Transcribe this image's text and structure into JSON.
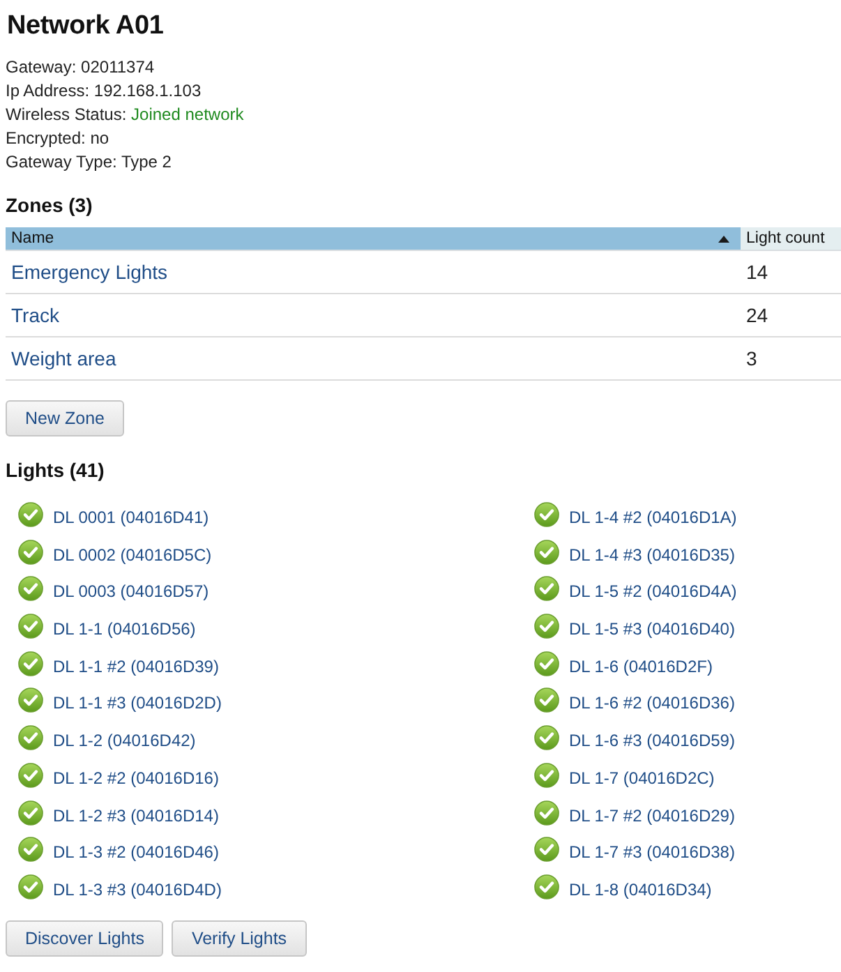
{
  "title": "Network A01",
  "details": [
    {
      "label": "Gateway:",
      "value": "02011374",
      "kind": "plain"
    },
    {
      "label": "Ip Address:",
      "value": "192.168.1.103",
      "kind": "plain"
    },
    {
      "label": "Wireless Status:",
      "value": "Joined network",
      "kind": "status"
    },
    {
      "label": "Encrypted:",
      "value": "no",
      "kind": "plain"
    },
    {
      "label": "Gateway Type:",
      "value": "Type 2",
      "kind": "plain"
    }
  ],
  "zones": {
    "heading": "Zones (3)",
    "columns": [
      {
        "label": "Name",
        "sorted": true
      },
      {
        "label": "Light count",
        "sorted": false
      }
    ],
    "rows": [
      {
        "name": "Emergency Lights",
        "light_count": "14"
      },
      {
        "name": "Track",
        "light_count": "24"
      },
      {
        "name": "Weight area",
        "light_count": "3"
      }
    ]
  },
  "zone_buttons": [
    "New Zone"
  ],
  "lights": {
    "heading": "Lights (41)",
    "items": [
      {
        "label": "DL 0001 (04016D41)",
        "verified": true
      },
      {
        "label": "DL 0002 (04016D5C)",
        "verified": true
      },
      {
        "label": "DL 0003 (04016D57)",
        "verified": true
      },
      {
        "label": "DL 1-1 (04016D56)",
        "verified": true
      },
      {
        "label": "DL 1-1 #2 (04016D39)",
        "verified": true
      },
      {
        "label": "DL 1-1 #3 (04016D2D)",
        "verified": true
      },
      {
        "label": "DL 1-2 (04016D42)",
        "verified": true
      },
      {
        "label": "DL 1-2 #2 (04016D16)",
        "verified": true
      },
      {
        "label": "DL 1-2 #3 (04016D14)",
        "verified": true
      },
      {
        "label": "DL 1-3 #2 (04016D46)",
        "verified": true
      },
      {
        "label": "DL 1-3 #3 (04016D4D)",
        "verified": true
      },
      {
        "label": "DL 1-4 #2 (04016D1A)",
        "verified": true
      },
      {
        "label": "DL 1-4 #3 (04016D35)",
        "verified": true
      },
      {
        "label": "DL 1-5 #2 (04016D4A)",
        "verified": true
      },
      {
        "label": "DL 1-5 #3 (04016D40)",
        "verified": true
      },
      {
        "label": "DL 1-6 (04016D2F)",
        "verified": true
      },
      {
        "label": "DL 1-6 #2 (04016D36)",
        "verified": true
      },
      {
        "label": "DL 1-6 #3 (04016D59)",
        "verified": true
      },
      {
        "label": "DL 1-7 (04016D2C)",
        "verified": true
      },
      {
        "label": "DL 1-7 #2 (04016D29)",
        "verified": true
      },
      {
        "label": "DL 1-7 #3 (04016D38)",
        "verified": true
      },
      {
        "label": "DL 1-8 (04016D34)",
        "verified": true
      }
    ]
  },
  "light_buttons": [
    "Discover Lights",
    "Verify Lights"
  ]
}
